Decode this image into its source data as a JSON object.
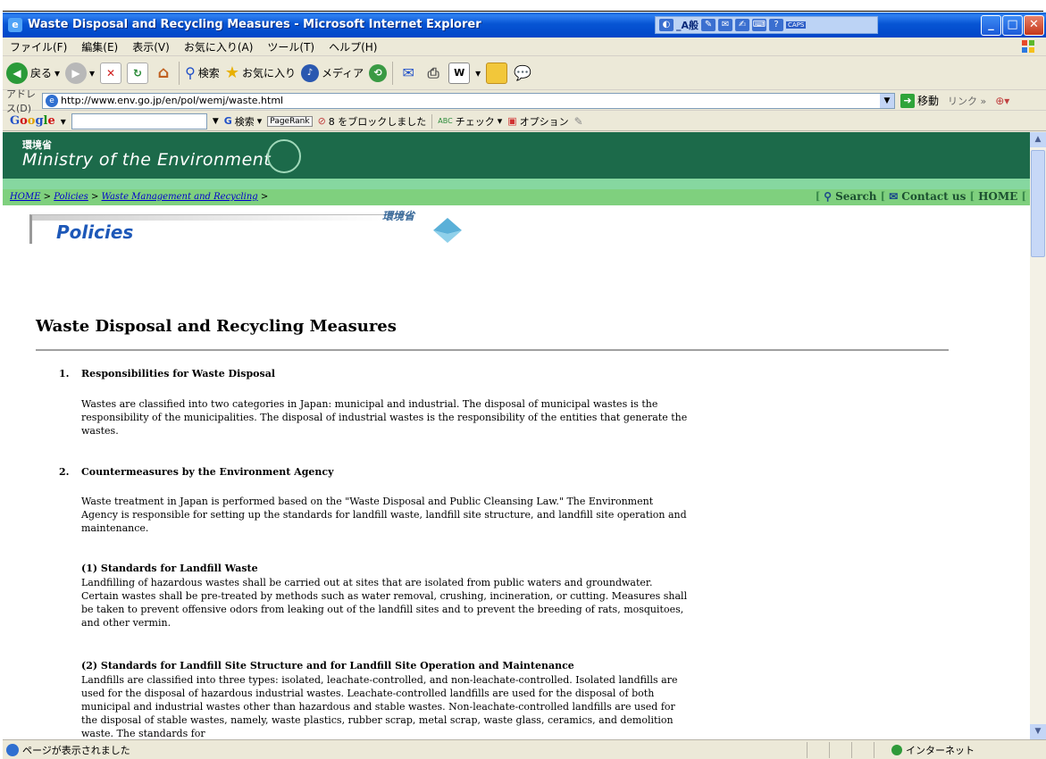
{
  "window": {
    "title": "Waste Disposal and Recycling Measures - Microsoft Internet Explorer",
    "ime": {
      "mode": "_A般",
      "caps": "CAPS",
      "kana": "KANA"
    }
  },
  "menu": [
    "ファイル(F)",
    "編集(E)",
    "表示(V)",
    "お気に入り(A)",
    "ツール(T)",
    "ヘルプ(H)"
  ],
  "toolbar": {
    "back": "戻る",
    "search": "検索",
    "favorites": "お気に入り",
    "media": "メディア"
  },
  "address": {
    "label": "アドレス(D)",
    "url": "http://www.env.go.jp/en/pol/wemj/waste.html",
    "go": "移動",
    "links": "リンク »"
  },
  "googlebar": {
    "logo": "Google",
    "search": "検索",
    "pagerank": "PageRank",
    "blocked": "8 をブロックしました",
    "check": "チェック",
    "options": "オプション"
  },
  "site": {
    "jp_name": "環境省",
    "en_name": "Ministry of the Environment",
    "breadcrumbs": [
      "HOME",
      "Policies",
      "Waste Management and Recycling"
    ],
    "nav": [
      "Search",
      "Contact us",
      "HOME"
    ],
    "section_label": "Policies",
    "seal_text": "環境省"
  },
  "page": {
    "title": "Waste Disposal and Recycling Measures",
    "sections": [
      {
        "num": "1.",
        "title": "Responsibilities for Waste Disposal"
      },
      {
        "num": "2.",
        "title": "Countermeasures by the Environment Agency"
      }
    ],
    "paragraphs": {
      "p1": "Wastes are classified into two categories in Japan: municipal and industrial. The disposal of municipal wastes is the responsibility of the municipalities. The disposal of industrial wastes is the responsibility of the entities that generate the wastes.",
      "p2": "Waste treatment in Japan is performed based on the \"Waste Disposal and Public Cleansing Law.\" The Environment Agency is responsible for setting up the standards for landfill waste, landfill site structure, and landfill site operation and maintenance.",
      "sub1_title": "(1) Standards for Landfill Waste",
      "sub1": "Landfilling of hazardous wastes shall be carried out at sites that are isolated from public waters and groundwater. Certain wastes shall be pre-treated by methods such as water removal, crushing, incineration, or cutting. Measures shall be taken to prevent offensive odors from leaking out of the landfill sites and to prevent the breeding of rats, mosquitoes, and other vermin.",
      "sub2_title": "(2) Standards for Landfill Site Structure and for Landfill Site Operation and Maintenance",
      "sub2": "Landfills are classified into three types: isolated, leachate-controlled, and non-leachate-controlled. Isolated landfills are used for the disposal of hazardous industrial wastes. Leachate-controlled landfills are used for the disposal of both municipal and industrial wastes other than hazardous and stable wastes. Non-leachate-controlled landfills are used for the disposal of stable wastes, namely, waste plastics, rubber scrap, metal scrap, waste glass, ceramics, and demolition waste. The standards for"
    }
  },
  "status": {
    "text": "ページが表示されました",
    "zone": "インターネット"
  }
}
